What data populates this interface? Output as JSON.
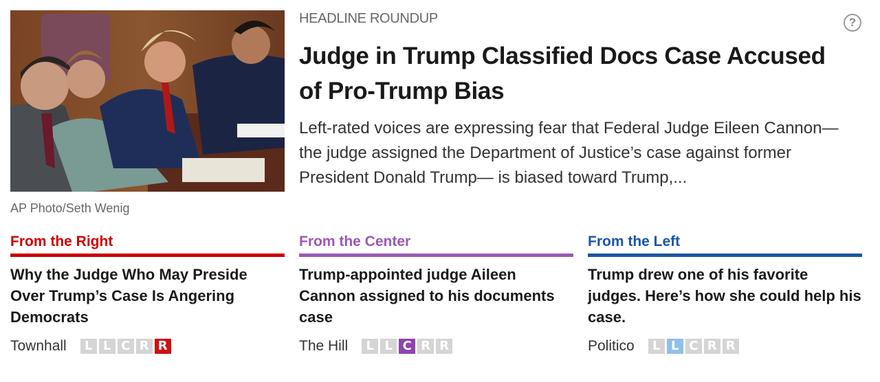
{
  "photo": {
    "alt": "Courtroom photo",
    "credit": "AP Photo/Seth Wenig"
  },
  "kicker": "HEADLINE ROUNDUP",
  "help_icon": "?",
  "headline": "Judge in Trump Classified Docs Case Accused of Pro-Trump Bias",
  "summary": "Left-rated voices are expressing fear that Federal Judge Eileen Cannon— the judge assigned the Department of Justice’s case against former President Donald Trump— is biased toward Trump,...",
  "columns": [
    {
      "label": "From the Right",
      "color": "#cc0000",
      "title": "Why the Judge Who May Preside Over Trump’s Case Is Angering Democrats",
      "source": "Townhall",
      "bias_letters": [
        "L",
        "L",
        "C",
        "R",
        "R"
      ],
      "bias_active": 4
    },
    {
      "label": "From the Center",
      "color": "#9b59b6",
      "title": "Trump-appointed judge Aileen Cannon assigned to his documents case",
      "source": "The Hill",
      "bias_letters": [
        "L",
        "L",
        "C",
        "R",
        "R"
      ],
      "bias_active": 2
    },
    {
      "label": "From the Left",
      "color": "#1a56a6",
      "title": "Trump drew one of his favorite judges. Here’s how she could help his case.",
      "source": "Politico",
      "bias_letters": [
        "L",
        "L",
        "C",
        "R",
        "R"
      ],
      "bias_active": 1
    }
  ],
  "bias_colors": {
    "active_right": "#cc1111",
    "active_center": "#8e44ad",
    "active_left": "#8fbfea",
    "inactive": "#d5d5d5"
  }
}
